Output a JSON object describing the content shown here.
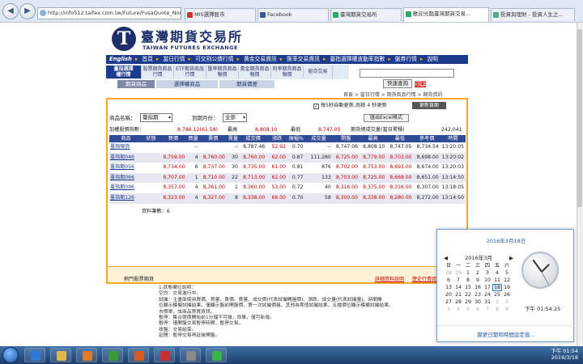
{
  "browser": {
    "address": "http://info512.taifex.com.tw/Future/FusaQuote_Norl.as",
    "tabs": [
      "MIS選擇股市",
      "Facebook",
      "臺灣期貨交易所",
      "歡迎光臨臺灣期貨交易...",
      "投資與理財 - 投資人生之..."
    ],
    "tab_colors": [
      "#c33",
      "#3b5998",
      "#2a6",
      "#2a6",
      "#5a8"
    ]
  },
  "site": {
    "logo_cn": "臺灣期貨交易所",
    "logo_en": "TAIWAN FUTURES EXCHANGE"
  },
  "nav": {
    "items": [
      "English",
      "首頁",
      "當日行情",
      "可交割公債行情",
      "黃金交易資訊",
      "匯率交易資訊",
      "臺指選擇權波動率指數",
      "盤券行情",
      "說明"
    ]
  },
  "subnav": {
    "items": [
      "臺指選擇\n權行情",
      "股票期貨商品\n行情",
      "ETF期貨商品\n行情",
      "匯率期貨商品\n報價",
      "黃金期貨商品\n報價",
      "利率期貨商品\n報價",
      "組合交易"
    ]
  },
  "subsub": {
    "items": [
      "期貨商品",
      "選擇權商品",
      "期貨價差"
    ]
  },
  "sort_button": "快速查詢",
  "explain_link": "說明",
  "breadcrumb": "首頁 > 當日行情 > 期貨商品行情 > 期貨資訊",
  "panel": {
    "refresh_label": "每5秒自動更新,尚餘 4 秒更新",
    "refresh_checked": "✓",
    "refresh_button": "更新頁面",
    "product_label": "商品名稱：",
    "product_value": "臺指期",
    "month_label": "到期月份：",
    "month_value": "全部",
    "export_button": "匯出Excel格式",
    "summary": {
      "index_label": "加權股價指數：",
      "index_value": "8,786.12(61.58)",
      "high_label": "最高",
      "high_value": "8,808.10",
      "low_label": "最低",
      "low_value": "8,747.05",
      "volume_label": "期貨總成交量(當日累積)",
      "volume_value": "242,041"
    },
    "columns": [
      "商品",
      "狀態",
      "買價",
      "買量",
      "賣價",
      "賣量",
      "成交價",
      "漲跌",
      "振幅%",
      "成交量",
      "開盤",
      "最高",
      "最低",
      "參考價",
      "時間"
    ],
    "rows": [
      [
        "臺指現貨",
        "",
        "",
        "--",
        "",
        "--",
        "8,787.46",
        "52.92",
        "0.70",
        "--",
        "8,747.06",
        "8,808.10",
        "8,747.05",
        "8,734.54",
        "13:20:05"
      ],
      [
        "臺指期046",
        "",
        "8,759.00",
        "4",
        "8,760.00",
        "30",
        "8,760.00",
        "62.00",
        "0.87",
        "111,280",
        "8,725.00",
        "8,779.00",
        "8,703.00",
        "8,698.00",
        "13:20:02"
      ],
      [
        "臺指期056",
        "",
        "8,734.00",
        "6",
        "8,737.00",
        "30",
        "8,735.00",
        "61.00",
        "0.81",
        "876",
        "8,702.00",
        "8,753.00",
        "8,693.00",
        "8,674.00",
        "13:20:03"
      ],
      [
        "臺指期066",
        "",
        "8,707.00",
        "1",
        "8,710.00",
        "22",
        "8,713.00",
        "62.00",
        "0.77",
        "133",
        "8,703.00",
        "8,725.00",
        "8,668.00",
        "8,651.00",
        "13:14:50"
      ],
      [
        "臺指期096",
        "",
        "8,357.00",
        "4",
        "8,361.00",
        "1",
        "8,360.00",
        "53.00",
        "0.72",
        "40",
        "8,316.00",
        "8,375.00",
        "8,316.00",
        "8,307.00",
        "13:18:05"
      ],
      [
        "臺指期126",
        "",
        "8,323.00",
        "4",
        "8,327.00",
        "8",
        "8,338.00",
        "66.00",
        "0.70",
        "58",
        "8,300.00",
        "8,338.00",
        "8,280.00",
        "8,272.00",
        "13:14:50"
      ]
    ],
    "count": "資料筆數：6",
    "footer_left": "熱門股票期貨",
    "footer_r1": "詳細資料說明",
    "footer_r2": "歷史行情資料"
  },
  "notes": [
    "1.狀態欄位說明：",
    "空白：交易進行中。",
    "試撮：主畫面使用買價、買量、賣價、賣量、成交價(代表試撮開盤價)、漲跌、成交量(代表試撮量)。時間欄",
    "位顯示模擬試撮結果。僅顯示盤前開盤價，第一次試撮價格。其他為零值試撮結果，五檔價位顯示模擬試撮結果。",
    "市價單，該商品買賣資訊。",
    "暫停：集合競價開始前1分鐘不可撤，改單，僅可新增。",
    "暫停：僅開盤交易暫停時間，暫停交易。",
    "收盤：交易結束。",
    "延閒：暫停交易再延後開盤。"
  ],
  "clock": {
    "date": "2016年3月18日",
    "month": "2016年3月",
    "weekdays": [
      "日",
      "一",
      "二",
      "三",
      "四",
      "五",
      "六"
    ],
    "days": [
      "28",
      "29",
      "1",
      "2",
      "3",
      "4",
      "5",
      "6",
      "7",
      "8",
      "9",
      "10",
      "11",
      "12",
      "13",
      "14",
      "15",
      "16",
      "17",
      "18",
      "19",
      "20",
      "21",
      "22",
      "23",
      "24",
      "25",
      "26",
      "27",
      "28",
      "29",
      "30",
      "31",
      "1",
      "2",
      "3",
      "4",
      "5",
      "6",
      "7",
      "8",
      "9"
    ],
    "today": "18",
    "time": "下午 01:54:25",
    "link": "變更日期和時間設定值..."
  },
  "taskbar": {
    "time": "下午 01:54",
    "date": "2016/3/18"
  }
}
